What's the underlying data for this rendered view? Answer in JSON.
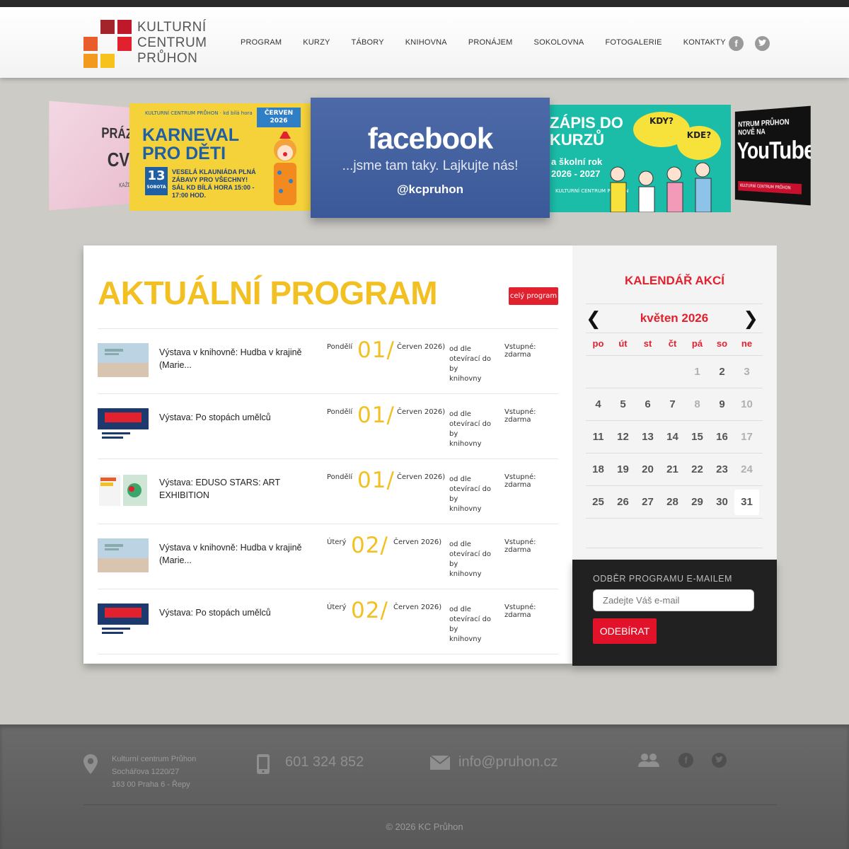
{
  "brand": {
    "line1": "KULTURNÍ",
    "line2": "CENTRUM",
    "line3": "PRŮHON"
  },
  "nav": {
    "items": [
      "PROGRAM",
      "KURZY",
      "TÁBORY",
      "KNIHOVNA",
      "PRONÁJEM",
      "SOKOLOVNA",
      "FOTOGALERIE",
      "KONTAKTY"
    ]
  },
  "social": {
    "facebook": "f",
    "twitter": "t"
  },
  "slides": {
    "s1": {
      "line1": "PRÁZ",
      "line2": "CV",
      "tag": "KAŽDÁ STŘ"
    },
    "s2": {
      "org": "KULTURNÍ CENTRUM PRŮHON",
      "org2": "kd bílá hora",
      "date": "ČERVEN 2026",
      "title1": "KARNEVAL",
      "title2": "PRO DĚTI",
      "day": "13",
      "weekday": "SOBOTA",
      "info": "VESELÁ KLAUNIÁDA PLNÁ ZÁBAVY PRO VŠECHNY! SÁL KD BÍLÁ HORA 15:00 - 17:00 HOD."
    },
    "s3": {
      "title": "facebook",
      "sub": "...jsme tam taky. Lajkujte nás!",
      "handle": "@kcpruhon"
    },
    "s4": {
      "title1": "ZÁPIS DO",
      "title2": "KURZŮ",
      "sub1": "a školní rok",
      "sub2": "2026 - 2027",
      "bubble1": "KDY?",
      "bubble2": "KDE?",
      "org": "KULTURNÍ CENTRUM PRŮHON"
    },
    "s5": {
      "line1": "NTRUM PRŮHON NOVĚ NA",
      "yt": "YouTube",
      "bar": "KULTURNÍ CENTRUM PRŮHON"
    }
  },
  "program": {
    "heading": "AKTUÁLNÍ PROGRAM",
    "all_button": "celý program",
    "events": [
      {
        "title": "Výstava v knihovně: Hudba v krajině (Marie...",
        "day": "Pondělí",
        "num": "01/",
        "month": "Červen 2026)",
        "place": "od dle otevírací do by knihovny",
        "price": "Vstupné: zdarma",
        "thumb": "landscape"
      },
      {
        "title": "Výstava: Po stopách umělců",
        "day": "Pondělí",
        "num": "01/",
        "month": "Červen 2026)",
        "place": "od dle otevírací do by knihovny",
        "price": "Vstupné: zdarma",
        "thumb": "poster"
      },
      {
        "title": "Výstava: EDUSO STARS: ART EXHIBITION",
        "day": "Pondělí",
        "num": "01/",
        "month": "Červen 2026)",
        "place": "od dle otevírací do by knihovny",
        "price": "Vstupné: zdarma",
        "thumb": "eduso"
      },
      {
        "title": "Výstava v knihovně: Hudba v krajině (Marie...",
        "day": "Úterý",
        "num": "02/",
        "month": "Červen 2026)",
        "place": "od dle otevírací do by knihovny",
        "price": "Vstupné: zdarma",
        "thumb": "landscape"
      },
      {
        "title": "Výstava: Po stopách umělců",
        "day": "Úterý",
        "num": "02/",
        "month": "Červen 2026)",
        "place": "od dle otevírací do by knihovny",
        "price": "Vstupné: zdarma",
        "thumb": "poster"
      }
    ]
  },
  "calendar": {
    "heading": "KALENDÁŘ AKCÍ",
    "month": "květen 2026",
    "prev": "❮",
    "next": "❯",
    "weekdays": [
      "po",
      "út",
      "st",
      "čt",
      "pá",
      "so",
      "ne"
    ],
    "weeks": [
      [
        "",
        "",
        "",
        "",
        "1",
        "2",
        "3"
      ],
      [
        "4",
        "5",
        "6",
        "7",
        "8",
        "9",
        "10"
      ],
      [
        "11",
        "12",
        "13",
        "14",
        "15",
        "16",
        "17"
      ],
      [
        "18",
        "19",
        "20",
        "21",
        "22",
        "23",
        "24"
      ],
      [
        "25",
        "26",
        "27",
        "28",
        "29",
        "30",
        "31"
      ]
    ],
    "dim_days": [
      "1",
      "3",
      "8",
      "10",
      "17",
      "24"
    ],
    "today": "31"
  },
  "newsletter": {
    "label": "ODBĚR PROGRAMU E-MAILEM",
    "placeholder": "Zadejte Váš e-mail",
    "button": "ODEBÍRAT"
  },
  "footer": {
    "address": [
      "Kulturní centrum Průhon",
      "Sochářova 1220/27",
      "163 00 Praha 6 - Řepy"
    ],
    "phone": "601 324 852",
    "email": "info@pruhon.cz",
    "copyright": "© 2026 KC Průhon"
  },
  "colors": {
    "accent_yellow": "#f2c022",
    "accent_red": "#e2212f",
    "facebook_blue": "#3b5998"
  }
}
